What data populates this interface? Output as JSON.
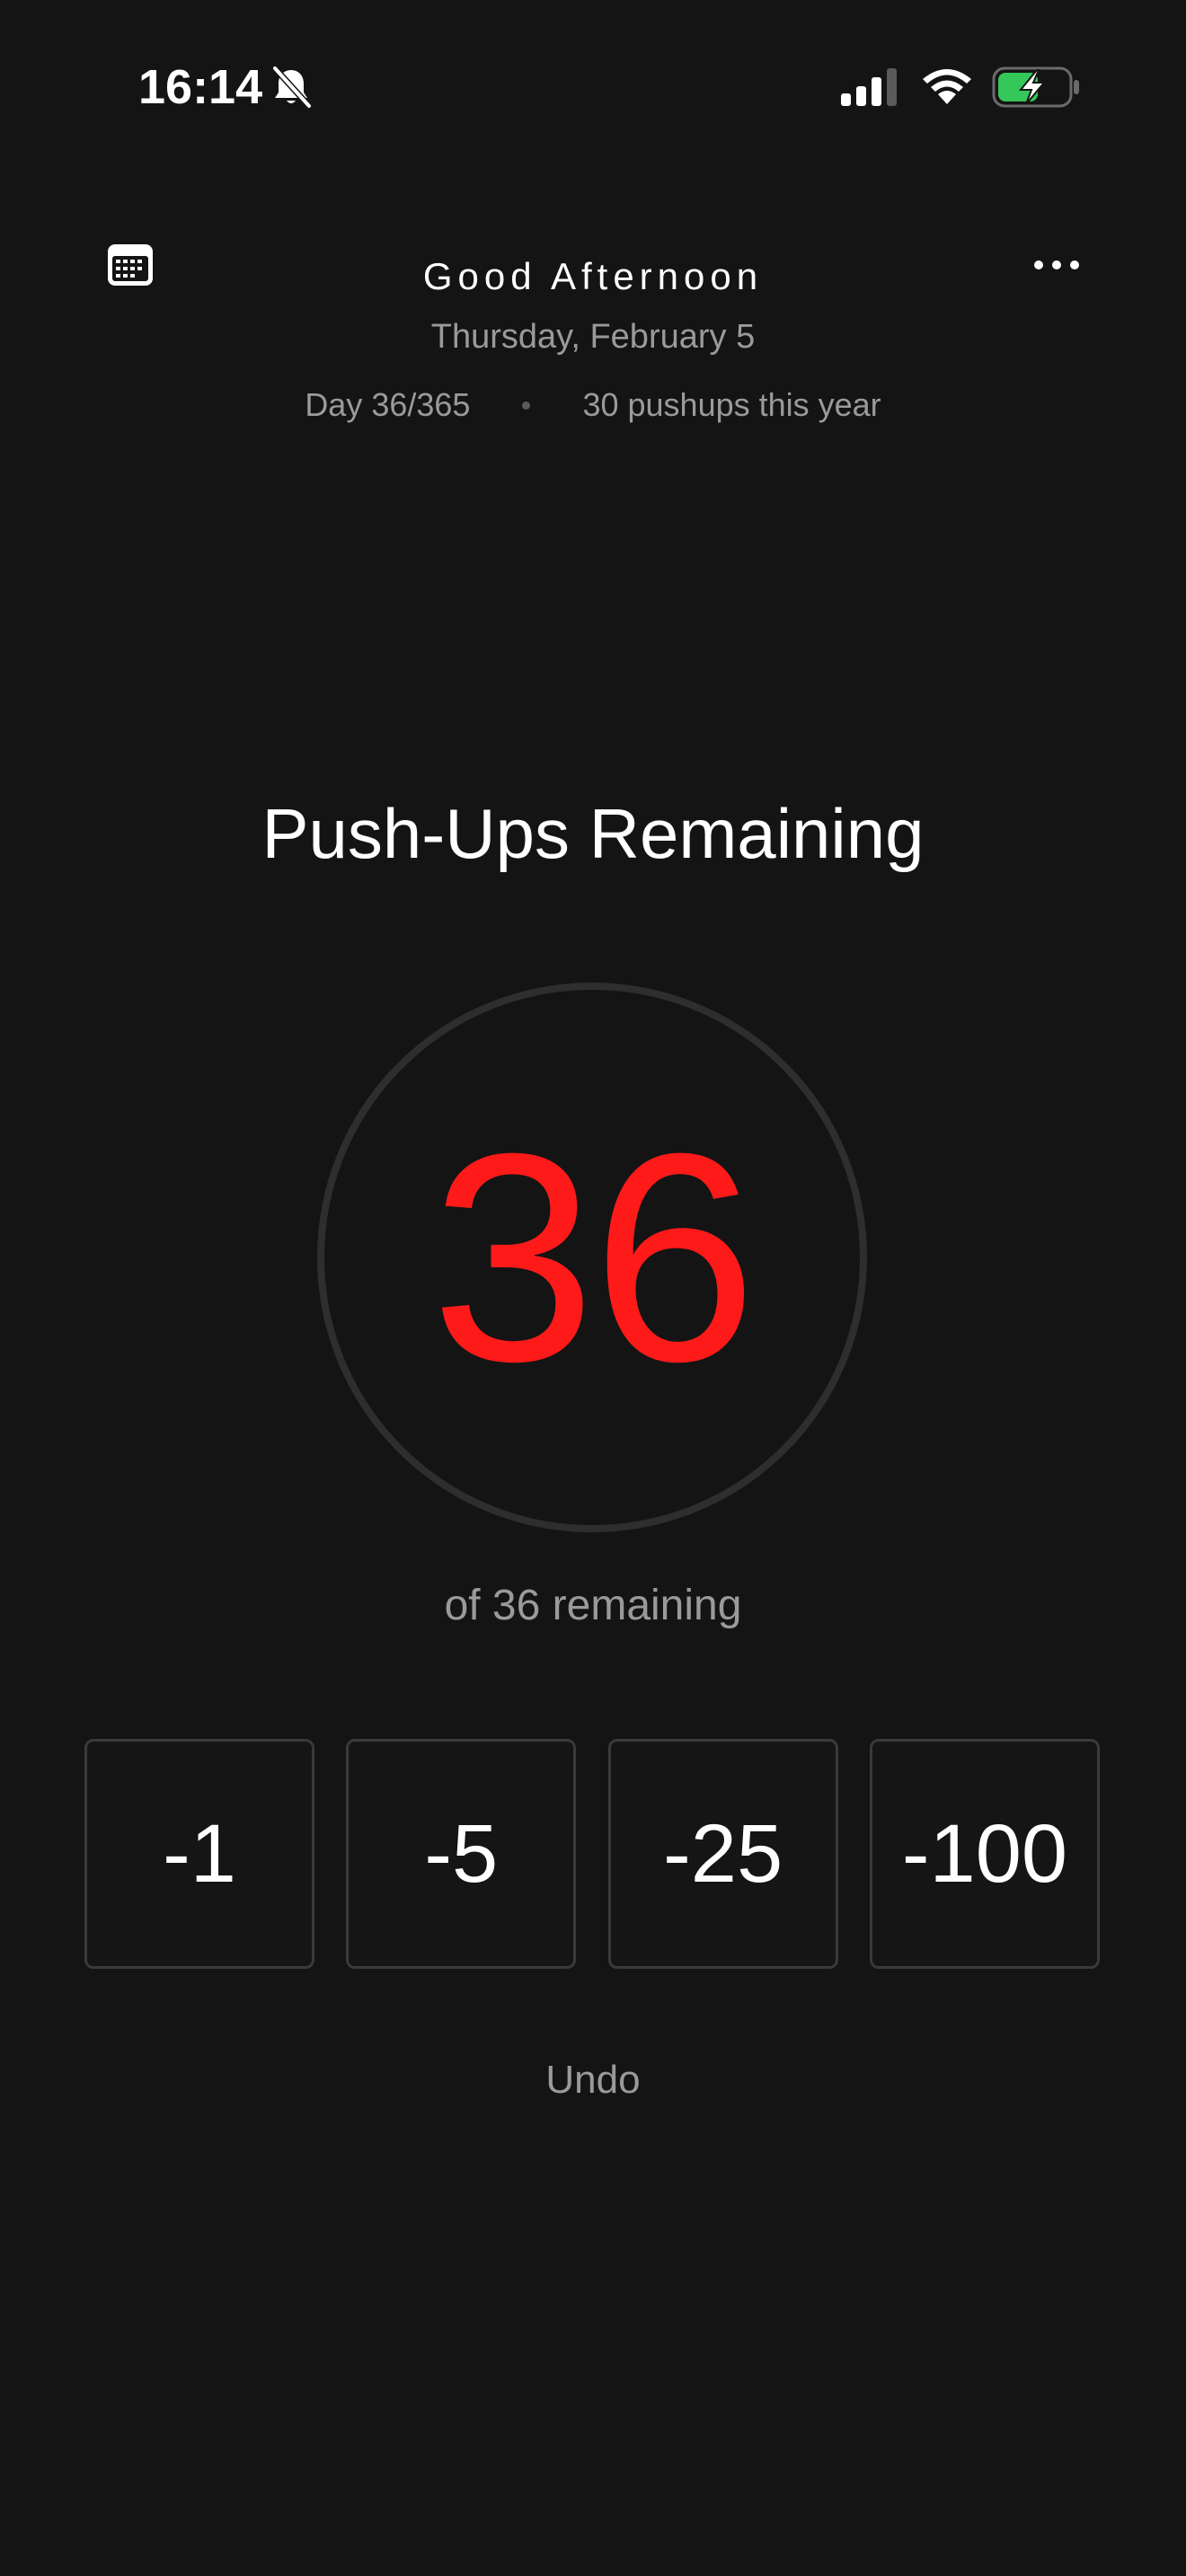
{
  "status_bar": {
    "time": "16:14",
    "icons": [
      "bell-slash-icon",
      "cellular-signal-icon",
      "wifi-icon",
      "battery-charging-icon"
    ],
    "battery_color": "#34c759"
  },
  "header": {
    "greeting": "Good Afternoon",
    "date": "Thursday, February 5",
    "day_progress": "Day 36/365",
    "year_total": "30 pushups this year",
    "left_icon": "calendar-icon",
    "right_icon": "ellipsis-icon"
  },
  "counter": {
    "title": "Push-Ups Remaining",
    "value": "36",
    "subtitle": "of 36 remaining",
    "value_color": "#ff1a1a",
    "ring_color": "#2e2e2e"
  },
  "buttons": [
    {
      "label": "-1"
    },
    {
      "label": "-5"
    },
    {
      "label": "-25"
    },
    {
      "label": "-100"
    }
  ],
  "undo_label": "Undo"
}
